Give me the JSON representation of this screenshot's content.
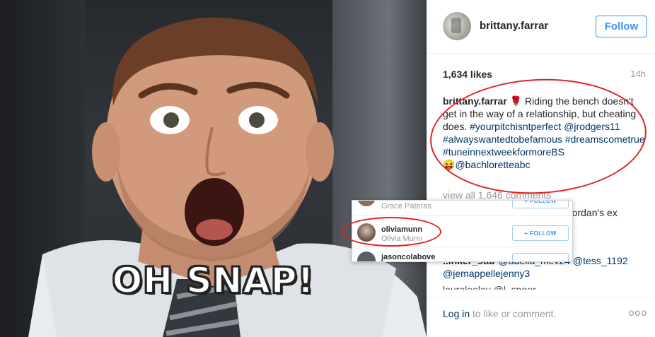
{
  "photo": {
    "caption": "OH SNAP!"
  },
  "post": {
    "username": "brittany.farrar",
    "follow_label": "Follow",
    "likes": "1,634 likes",
    "time_ago": "14h",
    "caption_user": "brittany.farrar",
    "caption_emoji": "🌹",
    "caption_text": " Riding the bench doesn't get in the way of a relationship, but cheating does. ",
    "caption_tags": "#yourpitchisntperfect @jrodgers11 #alwayswantedtobefamous #dreamscometrue #tuneinnextweekformoreBS",
    "caption_emoji2": "😝",
    "caption_mention": "@bachloretteabc",
    "view_all": "view all 1,646 comments",
    "comment_fragment_1": "g Jordan's ex",
    "comment_user_2": "..inker_star",
    "comment_text_2": " @adella_mev24 @tess_1192",
    "comment_text_3": "@jemappellejenny3",
    "comment_fragment_4": "lauraleelay @l_spoor",
    "login_link": "Log in",
    "login_text": " to like or comment.",
    "more_icon": "ooo"
  },
  "popup": {
    "rows": [
      {
        "handle": "",
        "name": "Grace Pateras",
        "button": "+ FOLLOW"
      },
      {
        "handle": "oliviamunn",
        "name": "Olivia Munn",
        "button": "+ FOLLOW"
      },
      {
        "handle": "jasoncolabove",
        "name": "",
        "button": ""
      }
    ]
  },
  "colors": {
    "accent": "#3897f0",
    "link": "#003569",
    "highlight_ring": "#e02424"
  }
}
